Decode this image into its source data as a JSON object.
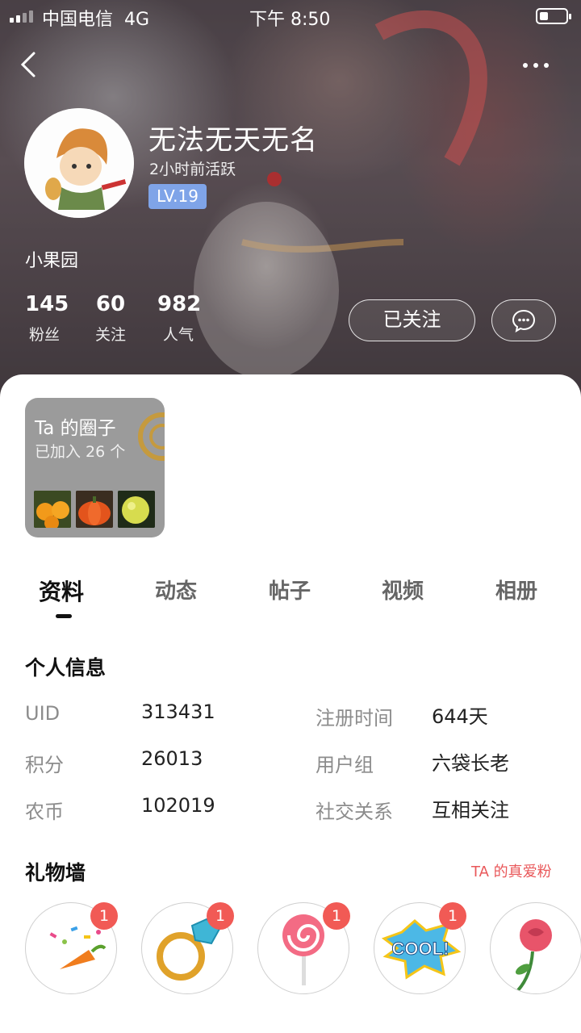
{
  "status_bar": {
    "carrier": "中国电信",
    "network": "4G",
    "time": "下午 8:50"
  },
  "profile": {
    "nickname": "无法无天无名",
    "last_active": "2小时前活跃",
    "level": "LV.19",
    "region": "小果园"
  },
  "stats": [
    {
      "value": "145",
      "label": "粉丝"
    },
    {
      "value": "60",
      "label": "关注"
    },
    {
      "value": "982",
      "label": "人气"
    }
  ],
  "actions": {
    "follow_label": "已关注"
  },
  "circle": {
    "title": "Ta 的圈子",
    "subtitle": "已加入 26 个"
  },
  "tabs": [
    "资料",
    "动态",
    "帖子",
    "视频",
    "相册"
  ],
  "personal_info": {
    "title": "个人信息",
    "rows": [
      {
        "label": "UID",
        "value": "313431",
        "label2": "注册时间",
        "value2": "644天"
      },
      {
        "label": "积分",
        "value": "26013",
        "label2": "用户组",
        "value2": "六袋长老"
      },
      {
        "label": "农币",
        "value": "102019",
        "label2": "社交关系",
        "value2": "互相关注"
      }
    ]
  },
  "gift_wall": {
    "title": "礼物墙",
    "link": "TA 的真爱粉",
    "gifts": [
      {
        "icon": "party-popper-carrot-icon",
        "count": "1"
      },
      {
        "icon": "diamond-ring-icon",
        "count": "1"
      },
      {
        "icon": "lollipop-icon",
        "count": "1"
      },
      {
        "icon": "cool-sticker-icon",
        "count": "1"
      },
      {
        "icon": "rose-icon"
      }
    ]
  },
  "colors": {
    "accent": "#f15a55",
    "level_badge": "#7fa4e8",
    "link": "#e9585a"
  }
}
